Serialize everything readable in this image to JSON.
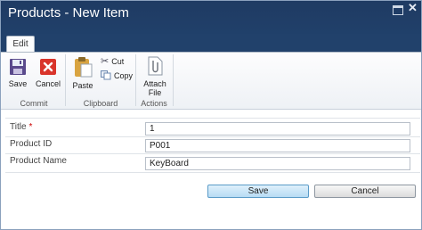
{
  "window": {
    "title": "Products - New Item"
  },
  "ribbon": {
    "tab": "Edit",
    "groups": {
      "commit": {
        "label": "Commit",
        "save": "Save",
        "cancel": "Cancel"
      },
      "clipboard": {
        "label": "Clipboard",
        "paste": "Paste",
        "cut": "Cut",
        "copy": "Copy"
      },
      "actions": {
        "label": "Actions",
        "attach_line1": "Attach",
        "attach_line2": "File"
      }
    }
  },
  "form": {
    "fields": [
      {
        "label": "Title",
        "required_marker": "*",
        "value": "1"
      },
      {
        "label": "Product ID",
        "value": "P001"
      },
      {
        "label": "Product Name",
        "value": "KeyBoard"
      }
    ],
    "save_label": "Save",
    "cancel_label": "Cancel"
  },
  "colors": {
    "titlebar": "#1f3b63",
    "accent": "#5a9bc8",
    "required": "#cc0000"
  }
}
